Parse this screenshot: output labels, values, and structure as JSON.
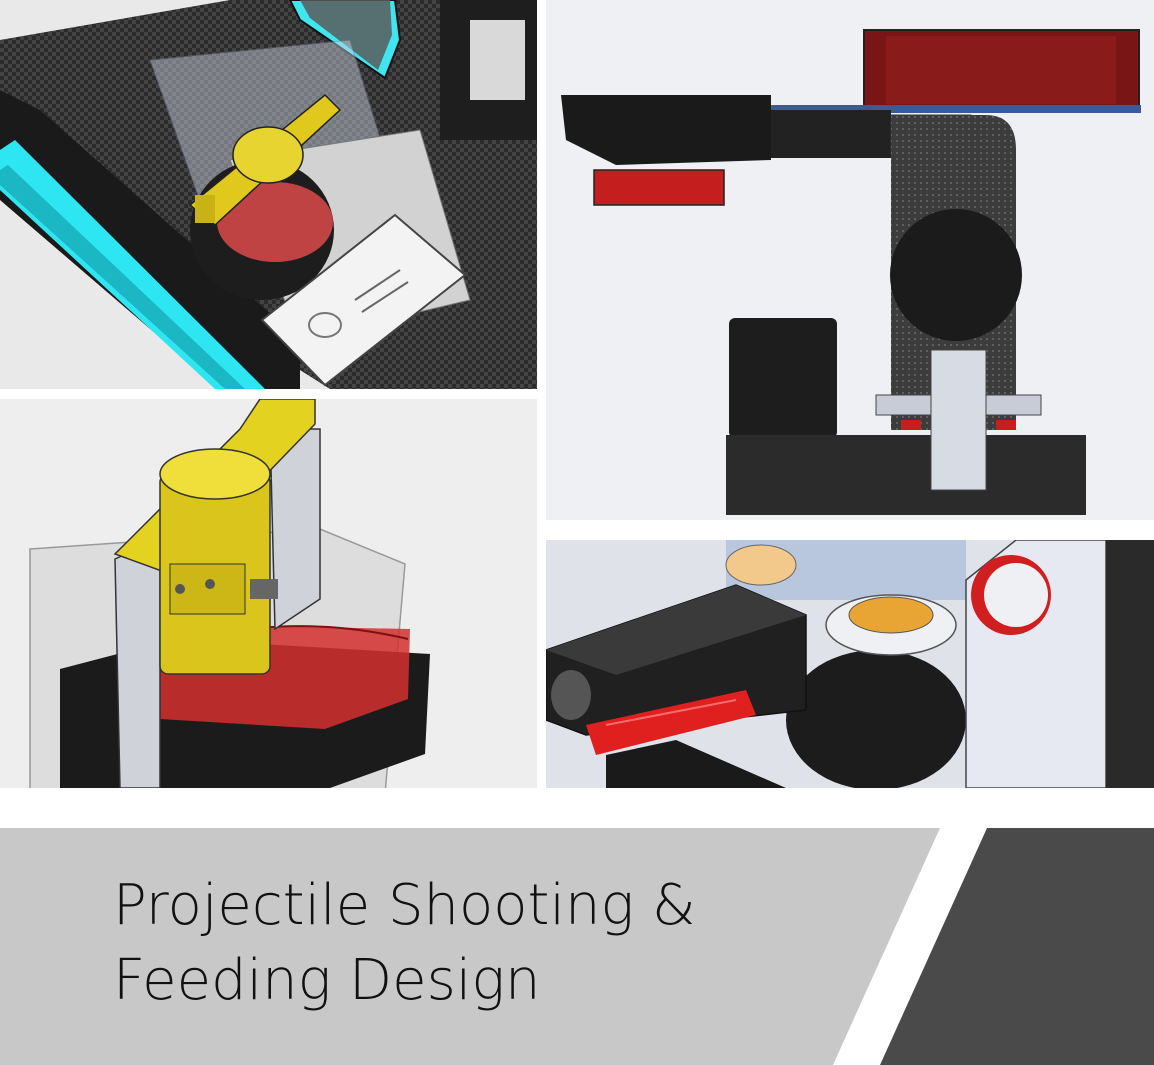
{
  "title": {
    "line1": "Projectile Shooting &",
    "line2": "Feeding Design"
  },
  "panels": [
    {
      "id": "top-left",
      "content": "cad-render-feeder-top-view"
    },
    {
      "id": "bottom-left",
      "content": "cad-render-feeder-closeup"
    },
    {
      "id": "top-right",
      "content": "cad-section-shooter-side-view"
    },
    {
      "id": "bottom-right",
      "content": "cad-render-shooter-assembly"
    }
  ],
  "colors": {
    "banner_light": "#c8c8c8",
    "banner_dark": "#4a4a4a",
    "accent_yellow": "#d8c41c",
    "accent_red": "#c21a1a",
    "accent_cyan": "#2de3f0"
  }
}
